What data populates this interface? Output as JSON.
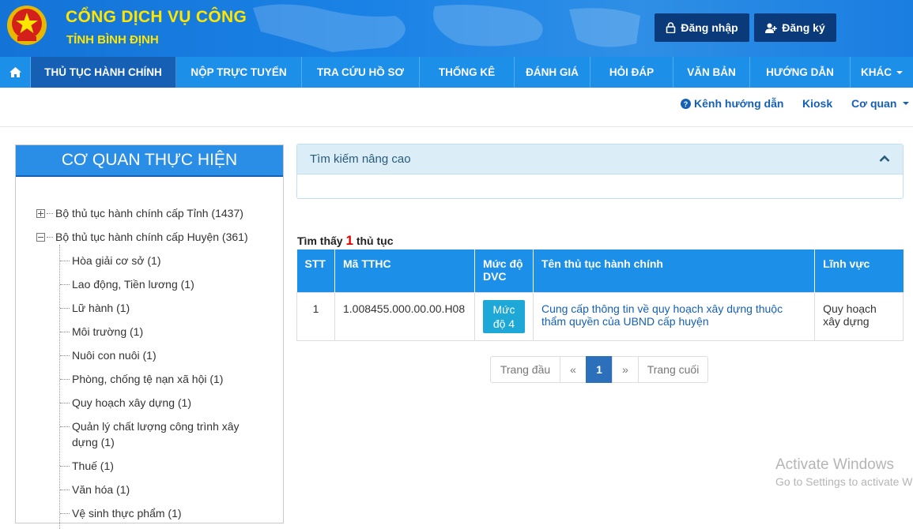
{
  "header": {
    "title": "CỔNG DỊCH VỤ CÔNG",
    "subtitle": "TỈNH BÌNH ĐỊNH",
    "login_label": "Đăng nhập",
    "register_label": "Đăng ký",
    "login_icon": "lock-icon",
    "register_icon": "user-plus-icon"
  },
  "nav": {
    "home_icon": "home-icon",
    "items": [
      "THỦ TỤC HÀNH CHÍNH",
      "NỘP TRỰC TUYẾN",
      "TRA CỨU HỒ SƠ",
      "THỐNG KÊ",
      "ĐÁNH GIÁ",
      "HỎI ĐÁP",
      "VĂN BẢN",
      "HƯỚNG DẪN",
      "KHÁC"
    ]
  },
  "subbar": {
    "guide_label": "Kênh hướng dẫn",
    "kiosk_label": "Kiosk",
    "agency_label": "Cơ quan"
  },
  "sidebar": {
    "title": "CƠ QUAN THỰC HIỆN",
    "roots": [
      "Bộ thủ tục hành chính cấp Tỉnh (1437)",
      "Bộ thủ tục hành chính cấp Huyện (361)"
    ],
    "children": [
      "Hòa giải cơ sở (1)",
      "Lao động, Tiền lương (1)",
      "Lữ hành (1)",
      "Môi trường (1)",
      "Nuôi con nuôi (1)",
      "Phòng, chống tệ nạn xã hội (1)",
      "Quy hoạch xây dựng (1)",
      "Quản lý chất lượng công trình xây dựng (1)",
      "Thuế (1)",
      "Văn hóa (1)",
      "Vệ sinh thực phẩm (1)"
    ]
  },
  "search": {
    "title": "Tìm kiếm nâng cao"
  },
  "results": {
    "prefix": "Tìm thấy",
    "count": "1",
    "suffix": "thủ tục",
    "columns": [
      "STT",
      "Mã TTHC",
      "Mức độ DVC",
      "Tên thủ tục hành chính",
      "Lĩnh vực"
    ],
    "rows": [
      {
        "stt": "1",
        "code": "1.008455.000.00.00.H08",
        "level": "Mức độ 4",
        "name": "Cung cấp thông tin về quy hoạch xây dựng thuộc thẩm quyền của UBND cấp huyện",
        "field": "Quy hoạch xây dựng"
      }
    ]
  },
  "pagination": {
    "first": "Trang đầu",
    "prev": "«",
    "current": "1",
    "next": "»",
    "last": "Trang cuối"
  },
  "watermark": {
    "line1": "Activate Windows",
    "line2": "Go to Settings to activate Windows."
  },
  "colors": {
    "header_blue": "#1a82e6",
    "nav_blue": "#1c8fe8",
    "title_yellow": "#ffe600",
    "active_nav": "#1560b5"
  }
}
